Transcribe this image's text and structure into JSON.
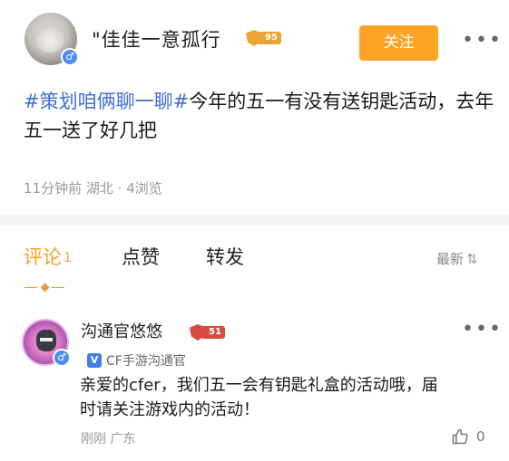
{
  "post": {
    "username": "\"佳佳一意孤行",
    "level": "95",
    "gender_symbol": "♂",
    "follow_label": "关注",
    "more_label": "•••",
    "hashtag": "#策划咱俩聊一聊#",
    "body": "今年的五一有没有送钥匙活动，去年五一送了好几把",
    "time": "11分钟前",
    "location": "湖北",
    "separator": "·",
    "views": "4浏览"
  },
  "tabs": {
    "comments_label": "评论",
    "comments_count": "1",
    "likes_label": "点赞",
    "reposts_label": "转发",
    "sort_label": "最新",
    "sort_icon": "⇅"
  },
  "comment": {
    "username": "沟通官悠悠",
    "level": "51",
    "gender_symbol": "♂",
    "more_label": "•••",
    "verified_icon": "V",
    "verified_label": "CF手游沟通官",
    "text": "亲爱的cfer，我们五一会有钥匙礼盒的活动哦，届时请关注游戏内的活动！",
    "time": "刚刚",
    "location": "广东",
    "like_count": "0"
  },
  "colors": {
    "accent": "#ffa327",
    "hashtag": "#3f6fd4",
    "active_tab": "#f3a02c",
    "verified": "#3f7de8"
  }
}
